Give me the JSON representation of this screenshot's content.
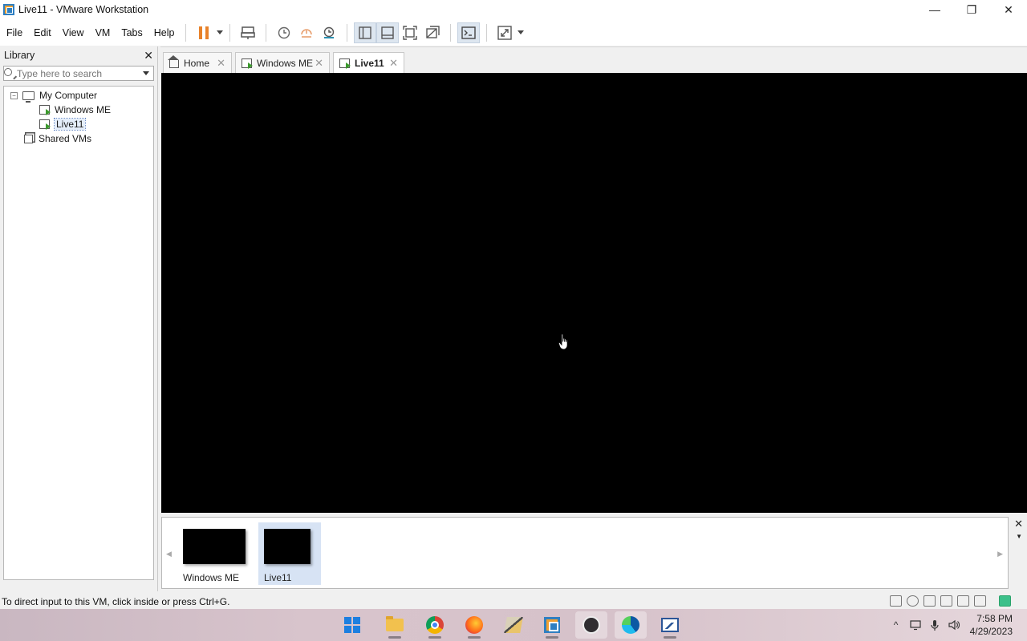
{
  "window": {
    "title": "Live11 - VMware Workstation",
    "minimize": "—",
    "restore": "❐",
    "close": "✕"
  },
  "menu": [
    "File",
    "Edit",
    "View",
    "VM",
    "Tabs",
    "Help"
  ],
  "library": {
    "title": "Library",
    "close": "✕",
    "search_placeholder": "Type here to search",
    "tree": {
      "expander": "−",
      "root": "My Computer",
      "children": [
        "Windows ME",
        "Live11"
      ],
      "shared": "Shared VMs"
    }
  },
  "tabs": [
    {
      "label": "Home",
      "close": "✕"
    },
    {
      "label": "Windows ME",
      "close": "✕"
    },
    {
      "label": "Live11",
      "close": "✕"
    }
  ],
  "thumbnails": {
    "items": [
      "Windows ME",
      "Live11"
    ],
    "close": "✕",
    "more": "▼",
    "scroll_left": "◀",
    "scroll_right": "▶"
  },
  "status": {
    "message": "To direct input to this VM, click inside or press Ctrl+G."
  },
  "taskbar": {
    "tray_chevron": "^",
    "time": "7:58 PM",
    "date": "4/29/2023"
  },
  "colors": {
    "pause_accent": "#e8822a",
    "vm_running_green": "#3c9a2e",
    "vm_screen": "#000000",
    "selected_thumb": "#d7e3f4"
  },
  "icons": [
    "pause-icon",
    "send-ctrl-alt-del-icon",
    "snapshot-icon",
    "revert-snapshot-icon",
    "snapshot-manager-icon",
    "library-view-icon",
    "thumbnail-bar-icon",
    "full-screen-icon",
    "unity-icon",
    "console-view-icon",
    "stretch-icon"
  ]
}
